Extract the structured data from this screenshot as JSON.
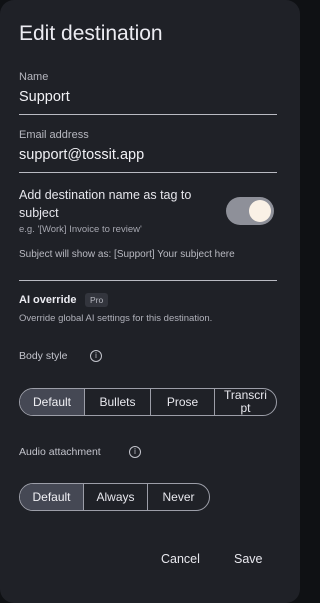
{
  "dialog": {
    "title": "Edit destination",
    "name_label": "Name",
    "name_value": "Support",
    "email_label": "Email address",
    "email_value": "support@tossit.app",
    "tag_toggle_label": "Add destination name as tag to subject",
    "tag_toggle_hint": "e.g. '[Work] Invoice to review'",
    "tag_toggle_on": true,
    "subject_preview": "Subject will show as: [Support] Your subject here",
    "ai_override": {
      "title": "AI override",
      "badge": "Pro",
      "description": "Override global AI settings for this destination."
    },
    "body_style": {
      "label": "Body style",
      "options": [
        "Default",
        "Bullets",
        "Prose",
        "Transcript"
      ],
      "selected": "Default"
    },
    "audio_attachment": {
      "label": "Audio attachment",
      "options": [
        "Default",
        "Always",
        "Never"
      ],
      "selected": "Default"
    },
    "cancel_label": "Cancel",
    "save_label": "Save"
  },
  "icons": {
    "info": "info-icon"
  },
  "colors": {
    "surface": "#1f2127",
    "selected_segment": "#454854",
    "toggle_track": "#8e9099",
    "toggle_knob": "#faf1e6"
  }
}
